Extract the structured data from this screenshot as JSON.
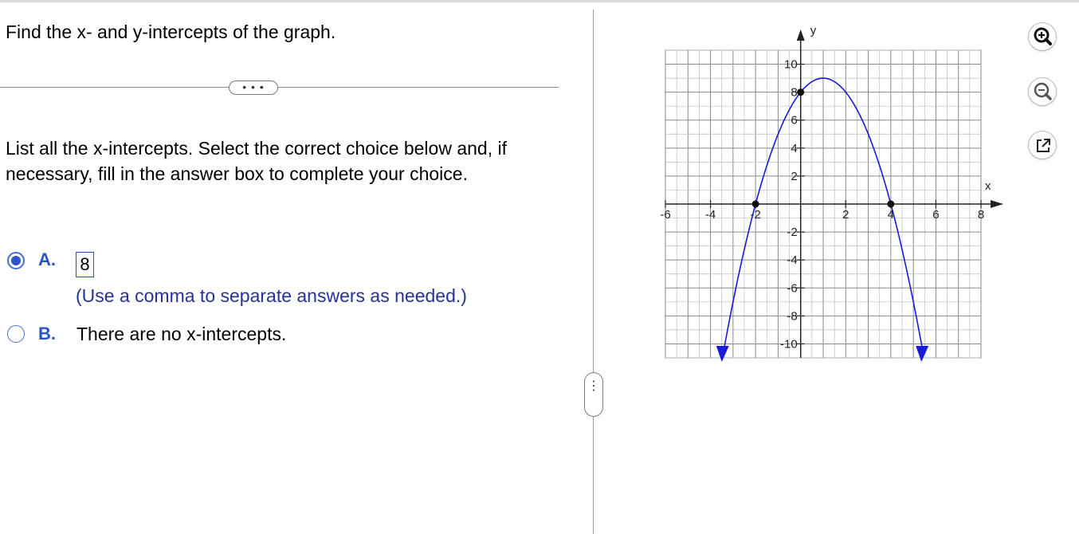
{
  "question": {
    "text": "Find the x- and y-intercepts of the graph."
  },
  "more_button": {
    "label": "• • •"
  },
  "instruction": {
    "text": "List all the x-intercepts. Select the correct choice below and, if necessary, fill in the answer box to complete your choice."
  },
  "choices": [
    {
      "letter": "A.",
      "selected": true,
      "answer_value": "8",
      "hint": "(Use a comma to separate answers as needed.)"
    },
    {
      "letter": "B.",
      "selected": false,
      "text": "There are no x-intercepts."
    }
  ],
  "side_handle": {
    "label": "⋮"
  },
  "graph": {
    "x_axis_label": "x",
    "y_axis_label": "y",
    "x_ticks": [
      "-6",
      "-4",
      "-2",
      "2",
      "4",
      "6",
      "8"
    ],
    "y_ticks": [
      "10",
      "8",
      "6",
      "4",
      "2",
      "-2",
      "-4",
      "-6",
      "-8",
      "-10"
    ],
    "x_range": [
      -6,
      8
    ],
    "y_range": [
      -11,
      11
    ],
    "curve": {
      "type": "parabola",
      "equation": "y = -(x - 1)^2 + 9",
      "vertex": [
        1,
        9
      ],
      "color": "#1a1adb"
    },
    "points": [
      {
        "x": -2,
        "y": 0
      },
      {
        "x": 4,
        "y": 0
      },
      {
        "x": 0,
        "y": 8
      }
    ]
  },
  "tools": [
    {
      "name": "zoom-in",
      "icon": "zoom-in-icon"
    },
    {
      "name": "zoom-out",
      "icon": "zoom-out-icon"
    },
    {
      "name": "open-external",
      "icon": "external-link-icon"
    }
  ],
  "colors": {
    "accent": "#2d55c0",
    "hint": "#26329a",
    "curve": "#1a1adb"
  }
}
